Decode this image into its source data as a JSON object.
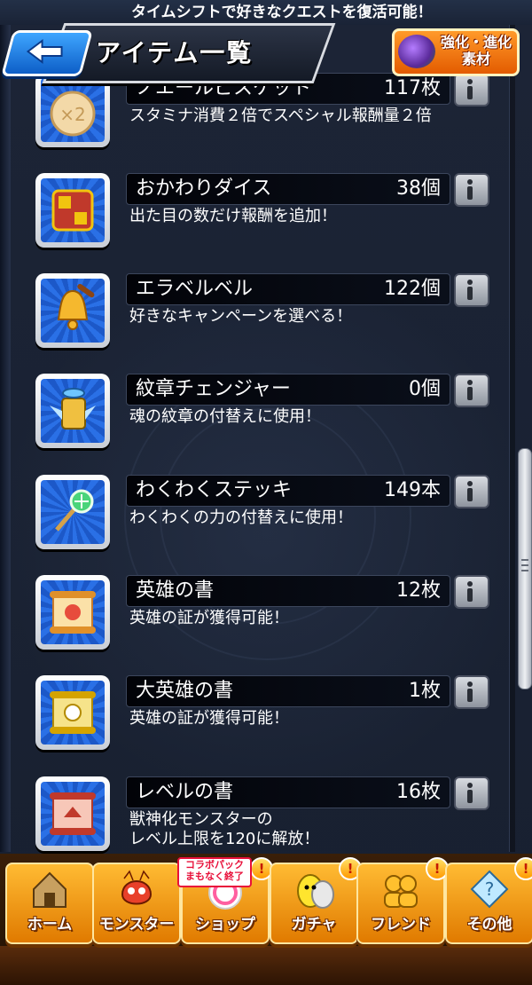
{
  "top": {
    "prev_item_desc": "タイムシフトで好きなクエストを復活可能！"
  },
  "header": {
    "title": "アイテム一覧",
    "back_icon": "back-arrow-icon"
  },
  "material_button": {
    "line1": "強化・進化",
    "line2": "素材"
  },
  "items": [
    {
      "name": "ノエールビスケット",
      "qty": "117枚",
      "desc": "スタミナ消費２倍でスペシャル報酬量２倍",
      "icon": "biscuit-icon"
    },
    {
      "name": "おかわりダイス",
      "qty": "38個",
      "desc": "出た目の数だけ報酬を追加！",
      "icon": "dice-icon"
    },
    {
      "name": "エラベルベル",
      "qty": "122個",
      "desc": "好きなキャンペーンを選べる！",
      "icon": "bell-icon"
    },
    {
      "name": "紋章チェンジャー",
      "qty": "0個",
      "desc": "魂の紋章の付替えに使用！",
      "icon": "emblem-changer-icon"
    },
    {
      "name": "わくわくステッキ",
      "qty": "149本",
      "desc": "わくわくの力の付替えに使用！",
      "icon": "wand-icon"
    },
    {
      "name": "英雄の書",
      "qty": "12枚",
      "desc": "英雄の証が獲得可能！",
      "icon": "scroll-icon"
    },
    {
      "name": "大英雄の書",
      "qty": "1枚",
      "desc": "英雄の証が獲得可能！",
      "icon": "gold-scroll-icon"
    },
    {
      "name": "レベルの書",
      "qty": "16枚",
      "desc": "獣神化モンスターの\nレベル上限を120に解放！",
      "icon": "red-scroll-icon"
    }
  ],
  "nav": {
    "collab_badge": {
      "line1": "コラボパック",
      "line2": "まもなく終了"
    },
    "buttons": [
      {
        "label": "ホーム",
        "icon": "home-icon",
        "alert": ""
      },
      {
        "label": "モンスター",
        "icon": "monster-icon",
        "alert": ""
      },
      {
        "label": "ショップ",
        "icon": "shop-icon",
        "alert": "!"
      },
      {
        "label": "ガチャ",
        "icon": "gacha-egg-icon",
        "alert": "!"
      },
      {
        "label": "フレンド",
        "icon": "friend-icon",
        "alert": "!"
      },
      {
        "label": "その他",
        "icon": "other-icon",
        "alert": "!"
      }
    ]
  },
  "colors": {
    "nav_orange": "#ffbb33",
    "icon_blue": "#1c58c8",
    "material_orange": "#ff9a2a"
  }
}
